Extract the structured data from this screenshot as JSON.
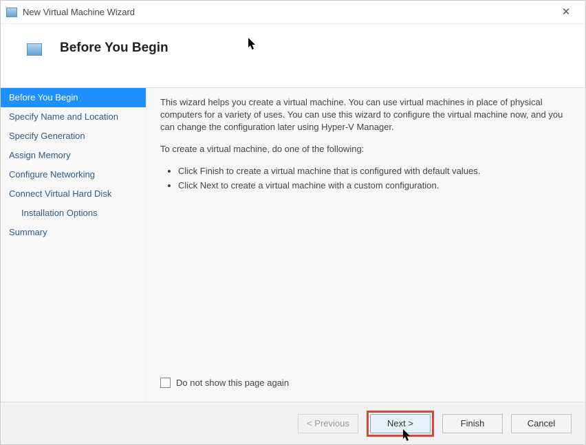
{
  "window": {
    "title": "New Virtual Machine Wizard"
  },
  "header": {
    "page_title": "Before You Begin"
  },
  "sidebar": {
    "items": [
      {
        "label": "Before You Begin",
        "selected": true,
        "sub": false
      },
      {
        "label": "Specify Name and Location",
        "selected": false,
        "sub": false
      },
      {
        "label": "Specify Generation",
        "selected": false,
        "sub": false
      },
      {
        "label": "Assign Memory",
        "selected": false,
        "sub": false
      },
      {
        "label": "Configure Networking",
        "selected": false,
        "sub": false
      },
      {
        "label": "Connect Virtual Hard Disk",
        "selected": false,
        "sub": false
      },
      {
        "label": "Installation Options",
        "selected": false,
        "sub": true
      },
      {
        "label": "Summary",
        "selected": false,
        "sub": false
      }
    ]
  },
  "content": {
    "intro": "This wizard helps you create a virtual machine. You can use virtual machines in place of physical computers for a variety of uses. You can use this wizard to configure the virtual machine now, and you can change the configuration later using Hyper-V Manager.",
    "subhead": "To create a virtual machine, do one of the following:",
    "bullets": [
      "Click Finish to create a virtual machine that is configured with default values.",
      "Click Next to create a virtual machine with a custom configuration."
    ],
    "checkbox_label": "Do not show this page again"
  },
  "footer": {
    "previous": "< Previous",
    "next": "Next >",
    "finish": "Finish",
    "cancel": "Cancel"
  }
}
